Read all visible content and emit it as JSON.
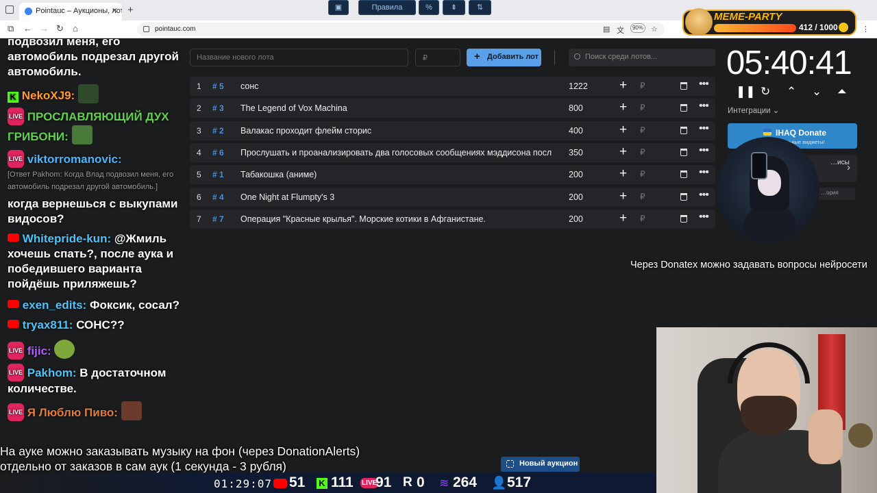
{
  "browser": {
    "tab_title": "Pointauc – Аукционы, лотереи",
    "url": "pointauc.com",
    "zoom": "90%"
  },
  "meme_party": {
    "title": "MEME-PARTY",
    "score": "412 / 1000"
  },
  "chat": {
    "lines": [
      {
        "text": "подвозил меня, его автомобиль подрезал другой автомобиль."
      },
      {
        "user": "NekoXJ9:",
        "color": "#ff9b2f"
      },
      {
        "user": "ПРОСЛАВЛЯЮЩИЙ ДУХ ГРИБОНИ:",
        "color": "#5fd14b"
      },
      {
        "user": "viktorromanovic:",
        "color": "#47b8ff"
      },
      {
        "quote": "[Ответ Pakhom: Когда Влад подвозил меня, его автомобиль подрезал другой автомобиль.]"
      },
      {
        "text": "когда вернешься с выкупами видосов?"
      },
      {
        "user": "Whitepride-kun:",
        "color": "#4fc3f7",
        "text": "@Жмиль хочешь спать?, после аука и победившего варианта пойдёшь приляжешь?"
      },
      {
        "user": "exen_edits:",
        "color": "#4fc3f7",
        "text": "Фоксик, сосал?"
      },
      {
        "user": "tryax811:",
        "color": "#4fc3f7",
        "text": "СОНС??"
      },
      {
        "user": "fijic:",
        "color": "#b05cff"
      },
      {
        "user": "Pakhom:",
        "color": "#4fc3f7",
        "text": "В достаточном количестве."
      },
      {
        "user": "Я Люблю Пиво:",
        "color": "#e07b39"
      }
    ]
  },
  "auction": {
    "new_lot_placeholder": "Название нового лота",
    "price_placeholder": "₽",
    "add_label": "Добавить лот",
    "search_placeholder": "Поиск среди лотов...",
    "currency": "₽",
    "lots": [
      {
        "n": "1",
        "id": "# 5",
        "name": "сонс",
        "amount": "1222"
      },
      {
        "n": "2",
        "id": "# 3",
        "name": "The Legend of Vox Machina",
        "amount": "800"
      },
      {
        "n": "3",
        "id": "# 2",
        "name": "Валакас проходит флейм сторис",
        "amount": "400"
      },
      {
        "n": "4",
        "id": "# 6",
        "name": "Прослушать и проанализировать два голосовых сообщениях мэддисона посл",
        "amount": "350"
      },
      {
        "n": "5",
        "id": "# 1",
        "name": "Табакошка (аниме)",
        "amount": "200"
      },
      {
        "n": "6",
        "id": "# 4",
        "name": "One Night at Flumpty's 3",
        "amount": "200"
      },
      {
        "n": "7",
        "id": "# 7",
        "name": "Операция \"Красные крылья\". Морские котики в Афганистане.",
        "amount": "200"
      }
    ]
  },
  "panel": {
    "timer": "05:40:41",
    "integrations_label": "Интеграции",
    "ihaq_title": "IHAQ Donate",
    "ihaq_sub": "…кальные виджеты!",
    "card2_text": "…исы",
    "card3_text": "…ория"
  },
  "overlay": {
    "donatex": "Через Donatex можно задавать вопросы нейросети",
    "subtitle_1": "На ауке можно заказывать музыку на фон (через DonationAlerts)",
    "subtitle_2": "отдельно от заказов в сам аук (1 секунда - 3 рубля)",
    "rules_label": "Правила",
    "percent_label": "%",
    "new_auction_label": "Новый аукцион"
  },
  "stats": {
    "uptime": "01:29:07",
    "youtube": "51",
    "kick": "111",
    "vk": "91",
    "rumble": "0",
    "twitch": "264",
    "total": "517"
  }
}
